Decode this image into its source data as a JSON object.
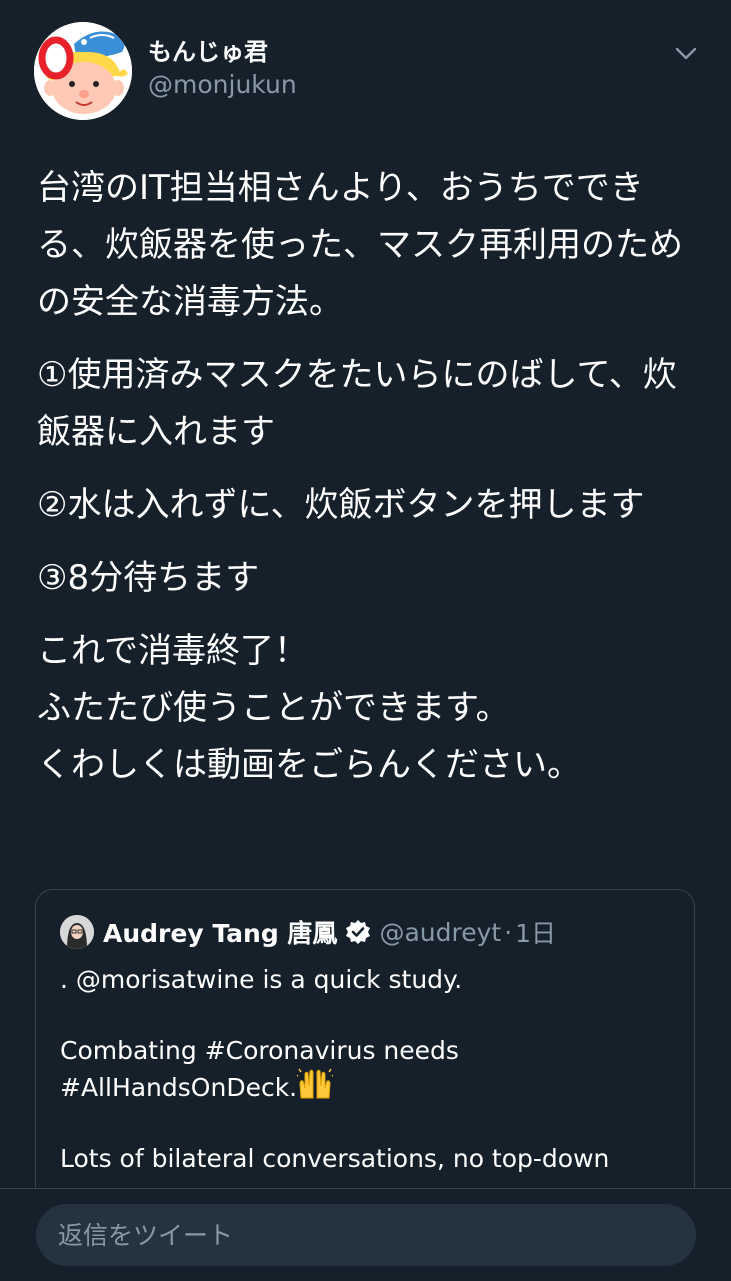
{
  "tweet": {
    "author": {
      "display_name": "もんじゅ君",
      "handle": "@monjukun",
      "avatar_icon": "cartoon-character-avatar"
    },
    "menu_icon": "chevron-down-icon",
    "paragraphs": [
      "台湾のIT担当相さんより、おうちでできる、炊飯器を使った、マスク再利用のための安全な消毒方法。",
      "①使用済みマスクをたいらにのばして、炊飯器に入れます",
      "②水は入れずに、炊飯ボタンを押します",
      "③8分待ちます",
      "これで消毒終了！\nふたたび使うことができます。\nくわしくは動画をごらんください。"
    ]
  },
  "quoted_tweet": {
    "display_name": "Audrey Tang 唐鳳",
    "verified_icon": "verified-badge-icon",
    "handle": "@audreyt",
    "separator": "·",
    "time": "1日",
    "paragraphs": [
      ". @morisatwine is a quick study.",
      "Combating #Coronavirus needs\n#AllHandsOnDeck.",
      "Lots of bilateral conversations, no top-down"
    ],
    "emoji": "raising-hands-emoji"
  },
  "reply": {
    "placeholder": "返信をツイート"
  },
  "colors": {
    "background": "#15202b",
    "text_primary": "#ffffff",
    "text_secondary": "#8899a6",
    "border": "#38444d",
    "accent_blue": "#1da1f2"
  }
}
